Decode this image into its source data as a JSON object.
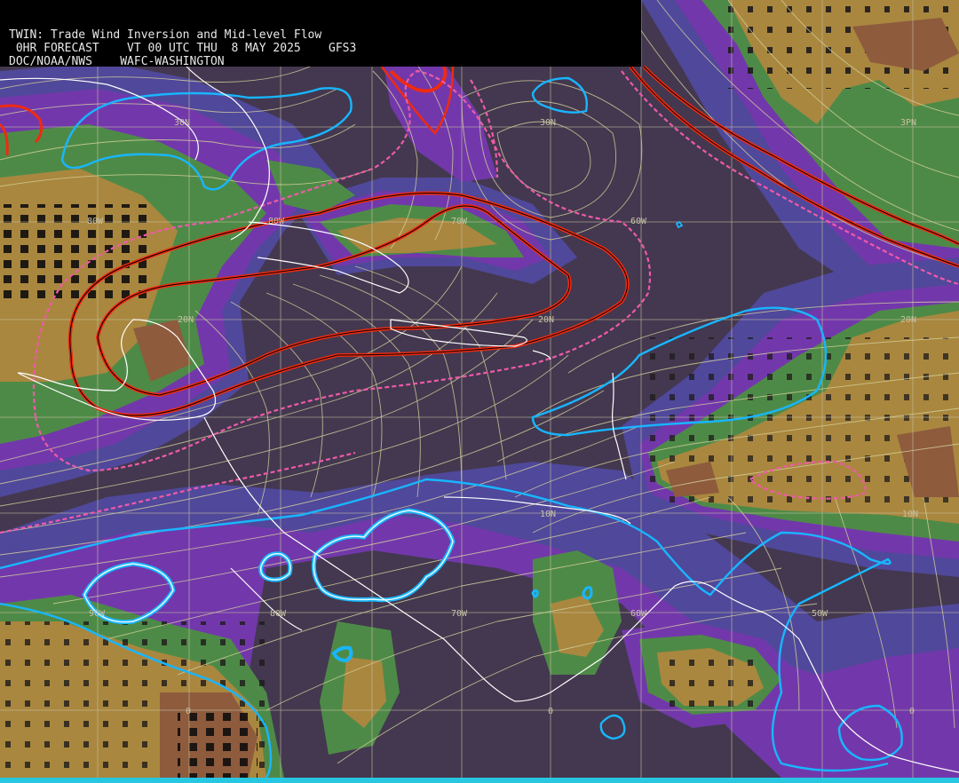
{
  "header": {
    "line1": "TWIN: Trade Wind Inversion and Mid-level Flow",
    "line2": " 0HR FORECAST    VT 00 UTC THU  8 MAY 2025    GFS3",
    "line3": "DOC/NOAA/NWS    WAFC-WASHINGTON"
  },
  "colors": {
    "background": "#43384f",
    "blue_level": "#50489a",
    "purple_level": "#7238ab",
    "green_level": "#4e8a47",
    "olive_level": "#7f8a3e",
    "tan_level": "#a9873f",
    "brown_level": "#8e5b3d",
    "streamline": "#d8d39e",
    "coastline": "#ffffff",
    "grid": "#c7c2a3",
    "inversion_contour_red": "#f02a10",
    "inversion_contour_pink": "#ee5aa8",
    "inversion_contour_cyan": "#18b6ff"
  },
  "grid_labels": {
    "lat_30n_a": "30N",
    "lat_30n_b": "30N",
    "lat_30n_c": "3PN",
    "lat_20n_a": "20N",
    "lat_20n_b": "20N",
    "lat_20n_c": "20N",
    "lat_10n_a": "10N",
    "lat_10n_b": "10N",
    "lon_80w_a": "80W",
    "lon_80w_b": "80W",
    "lon_70w_a": "70W",
    "lon_70w_b": "70W",
    "lon_60w_a": "60W",
    "lon_60w_b": "60W",
    "lon_90w": "90W",
    "lon_50w": "50W",
    "eq_a": "0",
    "eq_b": "0",
    "eq_c": "0"
  }
}
